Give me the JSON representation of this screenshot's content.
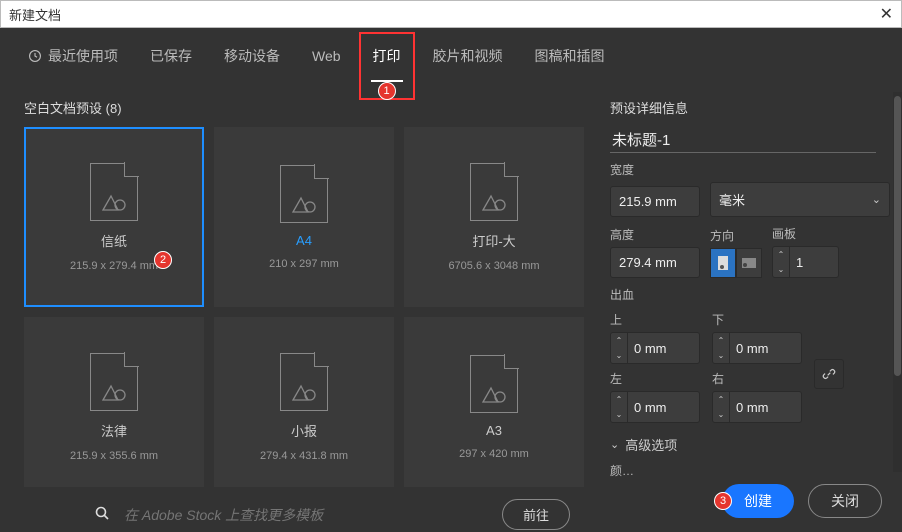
{
  "window": {
    "title": "新建文档",
    "close": "✕"
  },
  "tabs": {
    "recent": "最近使用项",
    "saved": "已保存",
    "mobile": "移动设备",
    "web": "Web",
    "print": "打印",
    "film": "胶片和视频",
    "art": "图稿和插图"
  },
  "markers": {
    "m1": "1",
    "m2": "2",
    "m3": "3"
  },
  "presets": {
    "heading_prefix": "空白文档预设",
    "count_display": "(8)",
    "items": [
      {
        "name": "信纸",
        "dim": "215.9 x 279.4 mm",
        "accent": false,
        "selected": true
      },
      {
        "name": "A4",
        "dim": "210 x 297 mm",
        "accent": true,
        "selected": false
      },
      {
        "name": "打印-大",
        "dim": "6705.6 x 3048 mm",
        "accent": false,
        "selected": false
      },
      {
        "name": "法律",
        "dim": "215.9 x 355.6 mm",
        "accent": false,
        "selected": false
      },
      {
        "name": "小报",
        "dim": "279.4 x 431.8 mm",
        "accent": false,
        "selected": false
      },
      {
        "name": "A3",
        "dim": "297 x 420 mm",
        "accent": false,
        "selected": false
      }
    ]
  },
  "search": {
    "placeholder": "在 Adobe Stock 上查找更多模板",
    "go": "前往"
  },
  "details": {
    "heading": "预设详细信息",
    "docname": "未标题-1",
    "width_label": "宽度",
    "width_value": "215.9 mm",
    "unit_label": "毫米",
    "height_label": "高度",
    "height_value": "279.4 mm",
    "orientation_label": "方向",
    "artboard_label": "画板",
    "artboard_value": "1",
    "bleed_label": "出血",
    "top": "上",
    "bottom": "下",
    "left": "左",
    "right": "右",
    "bleed_top": "0 mm",
    "bleed_bottom": "0 mm",
    "bleed_left": "0 mm",
    "bleed_right": "0 mm",
    "advanced": "高级选项",
    "truncated": "颜…"
  },
  "footer": {
    "create": "创建",
    "close": "关闭"
  }
}
